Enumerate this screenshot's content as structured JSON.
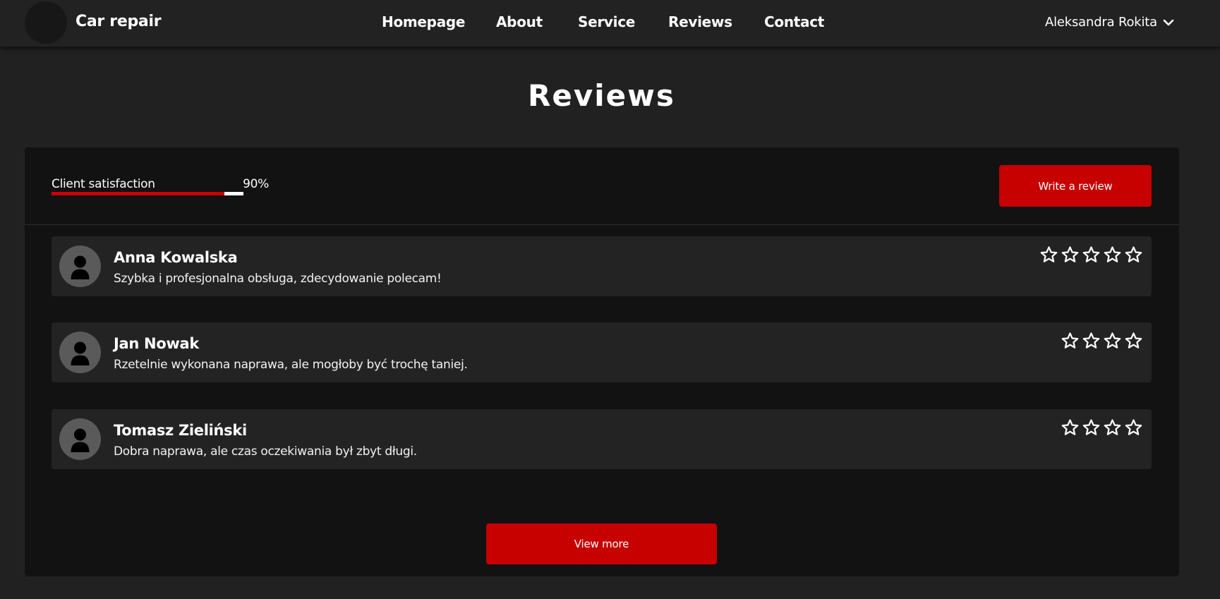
{
  "header": {
    "brand": "Car repair",
    "nav": [
      {
        "label": "Homepage"
      },
      {
        "label": "About"
      },
      {
        "label": "Service"
      },
      {
        "label": "Reviews"
      },
      {
        "label": "Contact"
      }
    ],
    "user": {
      "name": "Aleksandra Rokita",
      "icon": "chevron-down-icon"
    }
  },
  "page": {
    "title": "Reviews"
  },
  "satisfaction": {
    "label": "Client satisfaction",
    "value_text": "90%",
    "percent": 90
  },
  "actions": {
    "write_review": "Write a review",
    "view_more": "View more"
  },
  "reviews": [
    {
      "name": "Anna Kowalska",
      "text": "Szybka i profesjonalna obsługa, zdecydowanie polecam!",
      "stars": 5
    },
    {
      "name": "Jan Nowak",
      "text": "Rzetelnie wykonana naprawa, ale mogłoby być trochę taniej.",
      "stars": 4
    },
    {
      "name": "Tomasz Zieliński",
      "text": "Dobra naprawa, ale czas oczekiwania był zbyt długi.",
      "stars": 4
    }
  ],
  "colors": {
    "accent": "#c70000",
    "background": "#212121",
    "panel": "#121212",
    "card": "#232323"
  },
  "icons": {
    "avatar": "user-avatar-icon",
    "star": "star-outline-icon"
  }
}
